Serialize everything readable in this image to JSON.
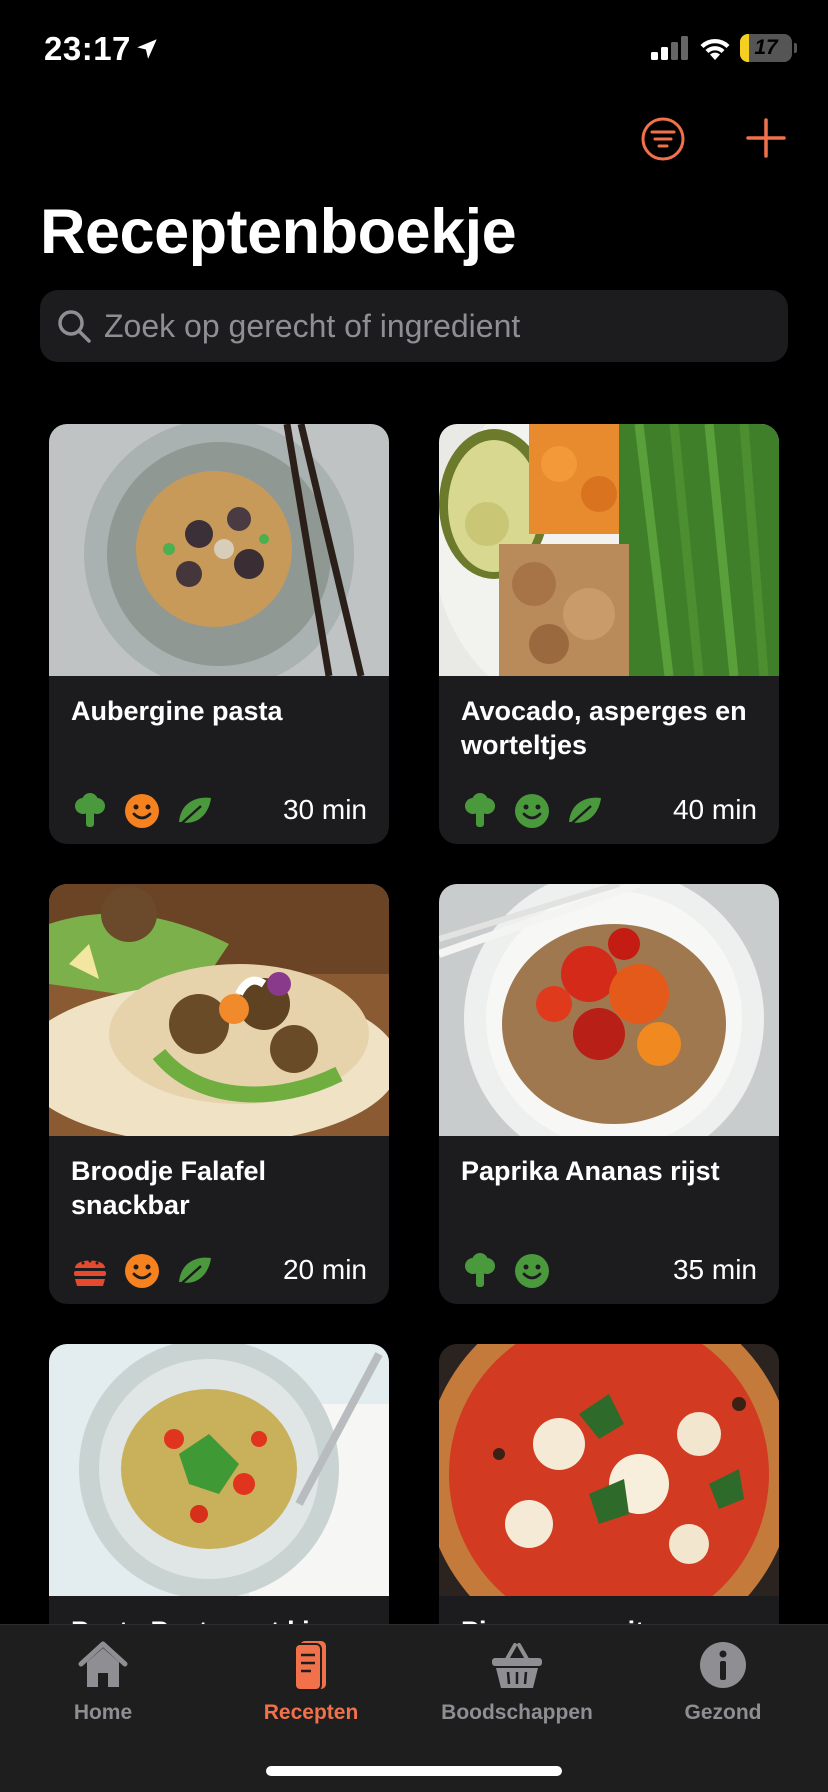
{
  "status_bar": {
    "time": "23:17",
    "battery": "17",
    "battery_level": 0.17,
    "icons": [
      "location-arrow-icon",
      "cellular-signal-icon",
      "wifi-icon",
      "battery-icon"
    ]
  },
  "header": {
    "title": "Receptenboekje",
    "filter_icon": "filter-lines-icon",
    "add_icon": "plus-icon"
  },
  "search": {
    "placeholder": "Zoek op gerecht of ingredient",
    "icon": "search-icon"
  },
  "colors": {
    "accent": "#f0714a",
    "green": "#4a9a3d",
    "orange": "#f5821f",
    "red": "#e64a2e",
    "card": "#1c1c1e",
    "background": "#000000"
  },
  "recipes": [
    {
      "title": "Aubergine pasta",
      "time": "30 min",
      "icons": [
        "broccoli-icon",
        "smiley-icon",
        "leaf-icon"
      ],
      "smiley_color": "orange"
    },
    {
      "title": "Avocado, asperges en worteltjes",
      "time": "40 min",
      "icons": [
        "broccoli-icon",
        "smiley-icon",
        "leaf-icon"
      ],
      "smiley_color": "green"
    },
    {
      "title": "Broodje Falafel snackbar",
      "time": "20 min",
      "icons": [
        "burger-icon",
        "smiley-icon",
        "leaf-icon"
      ],
      "smiley_color": "orange"
    },
    {
      "title": "Paprika Ananas rijst",
      "time": "35 min",
      "icons": [
        "broccoli-icon",
        "smiley-icon"
      ],
      "smiley_color": "green"
    },
    {
      "title": "Pasta Pesto met kip",
      "time": "",
      "icons": []
    },
    {
      "title": "Pizza margarita",
      "time": "",
      "icons": []
    }
  ],
  "tab_bar": {
    "tabs": [
      {
        "label": "Home",
        "icon": "house-icon",
        "active": false
      },
      {
        "label": "Recepten",
        "icon": "book-icon",
        "active": true
      },
      {
        "label": "Boodschappen",
        "icon": "basket-icon",
        "active": false
      },
      {
        "label": "Gezond",
        "icon": "info-icon",
        "active": false
      }
    ]
  }
}
